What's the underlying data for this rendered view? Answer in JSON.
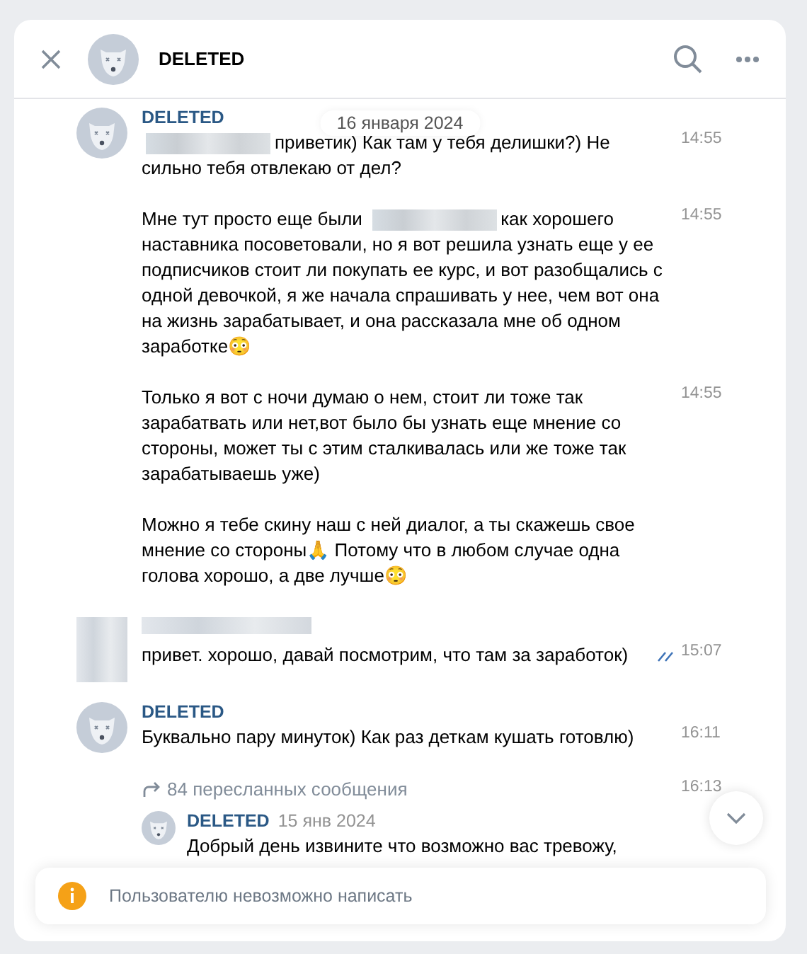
{
  "header": {
    "title": "DELETED"
  },
  "date_badge": "16 января 2024",
  "messages": [
    {
      "kind": "incoming",
      "author": "DELETED",
      "blocks": [
        {
          "time": "14:55",
          "parts": [
            {
              "kind": "redacted"
            },
            {
              "kind": "text",
              "text": "приветик) Как там у тебя делишки?) Не сильно тебя отвлекаю от дел?"
            }
          ]
        },
        {
          "time": "14:55",
          "parts": [
            {
              "kind": "text",
              "text": "Мне тут просто еще были"
            },
            {
              "kind": "redacted"
            },
            {
              "kind": "text",
              "text": "как хорошего наставника посоветовали, но я вот решила узнать еще у ее подписчиков стоит ли покупать ее курс, и вот разобщались с одной девочкой, я же начала спрашивать у нее, чем вот она на жизнь зарабатывает, и она рассказала мне об одном заработке😳"
            }
          ]
        },
        {
          "time": "14:55",
          "parts": [
            {
              "kind": "text",
              "text": "Только я вот с ночи думаю о нем, стоит ли тоже так зарабатвать или нет,вот было бы узнать еще мнение со стороны, может ты с этим сталкивалась или же тоже так зарабатываешь уже)"
            }
          ]
        },
        {
          "parts": [
            {
              "kind": "text",
              "text": "Можно я тебе скину наш с ней диалог, а ты скажешь свое мнение со стороны🙏 Потому что в любом случае одна голова хорошо, а две лучше😳"
            }
          ]
        }
      ]
    },
    {
      "kind": "outgoing",
      "read": true,
      "blocks": [
        {
          "time": "15:07",
          "parts": [
            {
              "kind": "text",
              "text": "привет. хорошо, давай посмотрим, что там за заработок)"
            }
          ]
        }
      ]
    },
    {
      "kind": "incoming",
      "author": "DELETED",
      "blocks": [
        {
          "time": "16:11",
          "parts": [
            {
              "kind": "text",
              "text": "Буквально пару минуток) Как раз деткам кушать готовлю)"
            }
          ]
        }
      ]
    },
    {
      "kind": "forwarded",
      "label": "84 пересланных сообщения",
      "time": "16:13",
      "author": "DELETED",
      "date": "15 янв 2024",
      "text": "Добрый день извините что возможно вас тревожу,"
    }
  ],
  "notice": "Пользователю невозможно написать"
}
